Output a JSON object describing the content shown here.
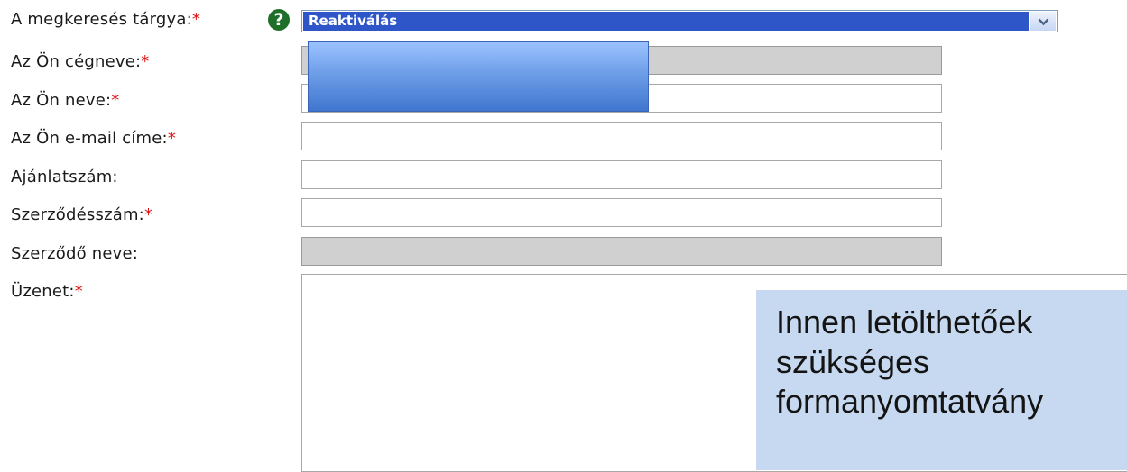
{
  "form": {
    "required_mark": "*",
    "help_icon_glyph": "?",
    "subject": {
      "label": "A megkeresés tárgya:",
      "selected_value": "Reaktiválás"
    },
    "fields": [
      {
        "label": "Az Ön cégneve:",
        "required": true,
        "disabled": true
      },
      {
        "label": "Az Ön neve:",
        "required": true,
        "disabled": false
      },
      {
        "label": "Az Ön e-mail címe:",
        "required": true,
        "disabled": false
      },
      {
        "label": "Ajánlatszám:",
        "required": false,
        "disabled": false
      },
      {
        "label": "Szerződésszám:",
        "required": true,
        "disabled": false
      },
      {
        "label": "Szerződő neve:",
        "required": false,
        "disabled": true
      }
    ],
    "message_label": "Üzenet:"
  },
  "callout": {
    "lines": [
      "Innen letölthetőek",
      "szükséges",
      "formanyomtatvány"
    ]
  },
  "colors": {
    "required": "#e01010",
    "select_highlight": "#2f56c9",
    "callout_bg": "#c7d9f0",
    "help_icon": "#1f6e2a"
  }
}
